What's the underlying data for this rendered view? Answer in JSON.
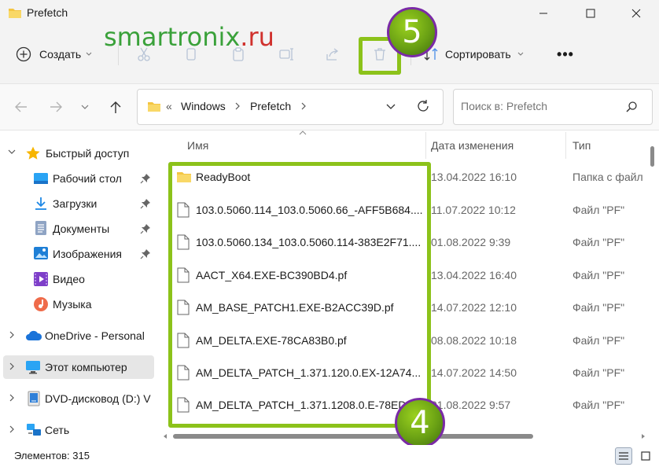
{
  "window": {
    "title": "Prefetch"
  },
  "watermark": {
    "part1": "smart",
    "part2": "ronix",
    "part3": ".ru"
  },
  "toolbar": {
    "create_label": "Создать",
    "sort_label": "Сортировать",
    "more_label": "•••"
  },
  "address": {
    "overflow": "«",
    "crumbs": [
      "Windows",
      "Prefetch"
    ],
    "search_placeholder": "Поиск в: Prefetch"
  },
  "sidebar": {
    "items": [
      {
        "label": "Быстрый доступ",
        "icon": "star-icon"
      },
      {
        "label": "Рабочий стол",
        "icon": "desktop-icon",
        "pinned": true
      },
      {
        "label": "Загрузки",
        "icon": "download-icon",
        "pinned": true
      },
      {
        "label": "Документы",
        "icon": "documents-icon",
        "pinned": true
      },
      {
        "label": "Изображения",
        "icon": "pictures-icon",
        "pinned": true
      },
      {
        "label": "Видео",
        "icon": "video-icon"
      },
      {
        "label": "Музыка",
        "icon": "music-icon"
      },
      {
        "label": "OneDrive - Personal",
        "icon": "cloud-icon"
      },
      {
        "label": "Этот компьютер",
        "icon": "computer-icon",
        "selected": true
      },
      {
        "label": "DVD-дисковод (D:) V",
        "icon": "dvd-icon"
      },
      {
        "label": "Сеть",
        "icon": "network-icon"
      }
    ]
  },
  "columns": {
    "name": "Имя",
    "date": "Дата изменения",
    "type": "Тип"
  },
  "files": [
    {
      "name": "ReadyBoot",
      "date": "13.04.2022 16:10",
      "type": "Папка с файл",
      "kind": "folder"
    },
    {
      "name": "103.0.5060.114_103.0.5060.66_-AFF5B684....",
      "date": "11.07.2022 10:12",
      "type": "Файл \"PF\"",
      "kind": "file"
    },
    {
      "name": "103.0.5060.134_103.0.5060.114-383E2F71....",
      "date": "01.08.2022 9:39",
      "type": "Файл \"PF\"",
      "kind": "file"
    },
    {
      "name": "AACT_X64.EXE-BC390BD4.pf",
      "date": "13.04.2022 16:40",
      "type": "Файл \"PF\"",
      "kind": "file"
    },
    {
      "name": "AM_BASE_PATCH1.EXE-B2ACC39D.pf",
      "date": "14.07.2022 12:10",
      "type": "Файл \"PF\"",
      "kind": "file"
    },
    {
      "name": "AM_DELTA.EXE-78CA83B0.pf",
      "date": "08.08.2022 10:18",
      "type": "Файл \"PF\"",
      "kind": "file"
    },
    {
      "name": "AM_DELTA_PATCH_1.371.120.0.EX-12A74...",
      "date": "14.07.2022 14:50",
      "type": "Файл \"PF\"",
      "kind": "file"
    },
    {
      "name": "AM_DELTA_PATCH_1.371.1208.0.E-78EDD...",
      "date": "01.08.2022 9:57",
      "type": "Файл \"PF\"",
      "kind": "file"
    }
  ],
  "status": {
    "count_text": "Элементов: 315"
  },
  "badges": {
    "step5": "5",
    "step4": "4"
  },
  "colors": {
    "accent": "#8cc21a",
    "badge_border": "#7a2aa6",
    "folder": "#f4c542",
    "watermark_green": "#3aa13a",
    "watermark_red": "#d0312d"
  }
}
